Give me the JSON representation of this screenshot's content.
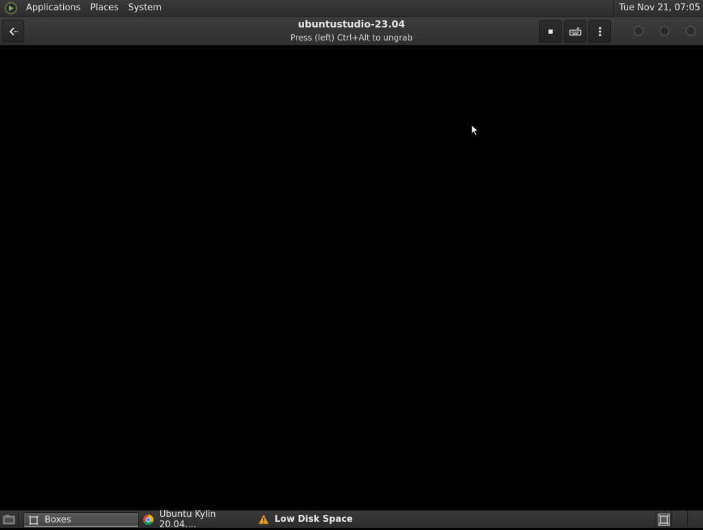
{
  "top_panel": {
    "menu": [
      "Applications",
      "Places",
      "System"
    ],
    "clock": "Tue Nov 21, 07:05"
  },
  "headerbar": {
    "title": "ubuntustudio-23.04",
    "subtitle": "Press (left) Ctrl+Alt to ungrab",
    "icons": {
      "back": "back-arrow-icon",
      "stop": "stop-icon",
      "keyboard": "keyboard-icon",
      "menu": "vertical-dots-menu-icon"
    }
  },
  "taskbar": {
    "tasks": [
      {
        "label": "Boxes",
        "icon": "boxes-app-icon",
        "active": true
      },
      {
        "label": "Ubuntu Kylin 20.04....",
        "icon": "chrome-icon",
        "active": false
      },
      {
        "label": "Low Disk Space",
        "icon": "warning-icon",
        "active": false
      }
    ]
  },
  "colors": {
    "panel_bg": "#333333",
    "viewport_bg": "#000000",
    "text": "#e8e8e8",
    "warning": "#f0a020"
  }
}
